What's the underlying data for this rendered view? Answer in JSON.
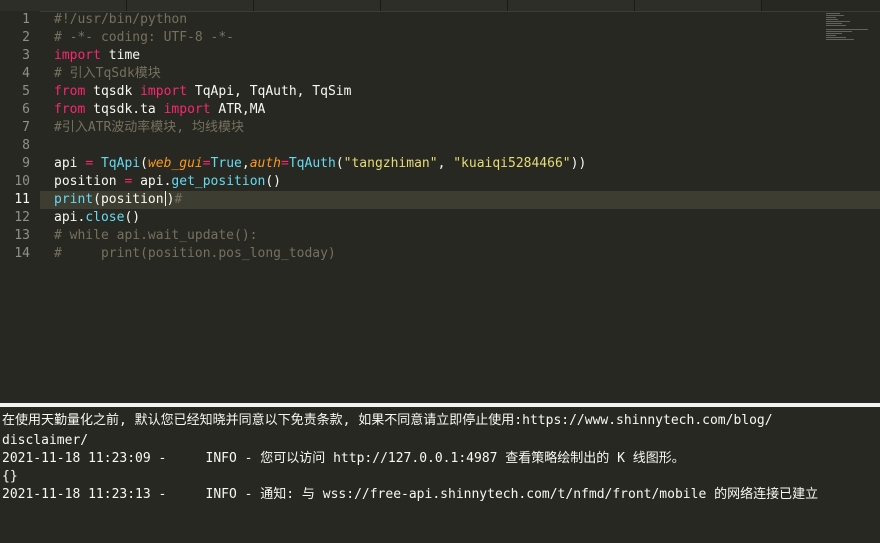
{
  "editor": {
    "line_numbers": [
      "1",
      "2",
      "3",
      "4",
      "5",
      "6",
      "7",
      "8",
      "9",
      "10",
      "11",
      "12",
      "13",
      "14"
    ],
    "lines": {
      "l1": "#!/usr/bin/python",
      "l2": "# -*- coding: UTF-8 -*-",
      "l3_kw": "import",
      "l3_mod": " time",
      "l4": "# 引入TqSdk模块",
      "l5_from": "from",
      "l5_mod": " tqsdk ",
      "l5_import": "import",
      "l5_names": " TqApi, TqAuth, TqSim",
      "l6_from": "from",
      "l6_mod": " tqsdk.ta ",
      "l6_import": "import",
      "l6_names": " ATR,MA",
      "l7": "#引入ATR波动率模块, 均线模块",
      "l9_var": "api ",
      "l9_eq": "=",
      "l9_sp": " ",
      "l9_fn": "TqApi",
      "l9_open": "(",
      "l9_p1": "web_gui",
      "l9_eq2": "=",
      "l9_true": "True",
      "l9_comma": ",",
      "l9_p2": "auth",
      "l9_eq3": "=",
      "l9_fn2": "TqAuth",
      "l9_open2": "(",
      "l9_s1": "\"tangzhiman\"",
      "l9_comma2": ", ",
      "l9_s2": "\"kuaiqi5284466\"",
      "l9_close": "))",
      "l10_var": "position ",
      "l10_eq": "=",
      "l10_obj": " api.",
      "l10_fn": "get_position",
      "l10_call": "()",
      "l11_fn": "print",
      "l11_arg": "(position",
      "l11_close": ")",
      "l11_cmt": "#",
      "l12_obj": "api.",
      "l12_fn": "close",
      "l12_call": "()",
      "l13": "# while api.wait_update():",
      "l14": "#     print(position.pos_long_today)"
    }
  },
  "console": {
    "lines": [
      "在使用天勤量化之前, 默认您已经知晓并同意以下免责条款, 如果不同意请立即停止使用:https://www.shinnytech.com/blog/",
      "disclaimer/",
      "2021-11-18 11:23:09 -     INFO - 您可以访问 http://127.0.0.1:4987 查看策略绘制出的 K 线图形。",
      "{}",
      "2021-11-18 11:23:13 -     INFO - 通知: 与 wss://free-api.shinnytech.com/t/nfmd/front/mobile 的网络连接已建立"
    ]
  },
  "colors": {
    "background": "#272822",
    "comment": "#75715e",
    "keyword": "#f92672",
    "function": "#66d9ef",
    "param": "#fd971f",
    "string": "#e6db74",
    "text": "#f8f8f2"
  }
}
